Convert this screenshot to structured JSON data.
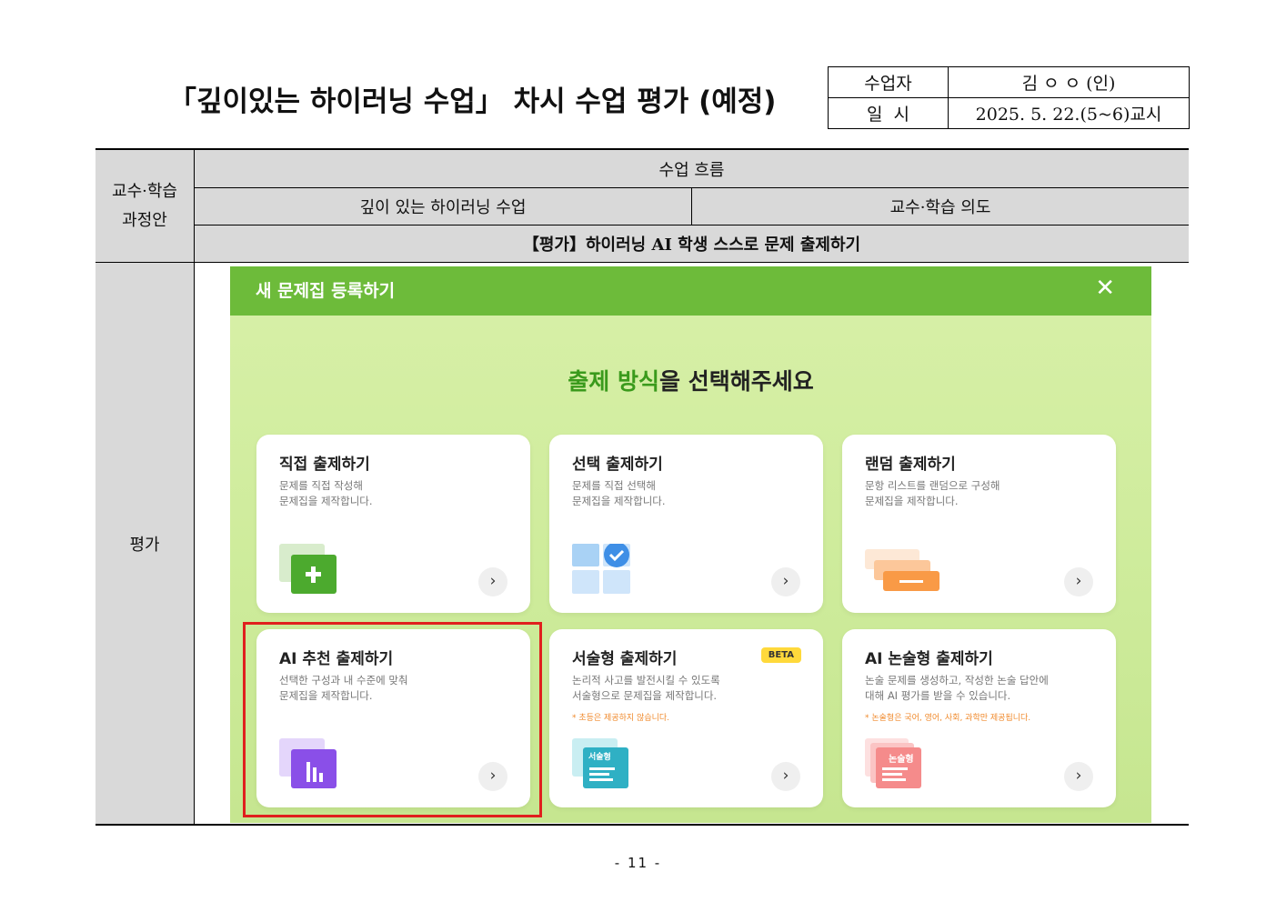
{
  "document": {
    "title": "「깊이있는 하이러닝 수업」 차시 수업 평가 (예정)",
    "meta": {
      "teacher_label": "수업자",
      "teacher_value": "김 ㅇ ㅇ (인)",
      "date_label": "일  시",
      "date_value": "2025. 5. 22.(5~6)교시"
    },
    "plan": {
      "left_top_line1": "교수·학습",
      "left_top_line2": "과정안",
      "left_bottom": "평가",
      "flow_header": "수업 흐름",
      "col_a": "깊이 있는 하이러닝 수업",
      "col_b": "교수·학습 의도",
      "activity_tag": "【평가】",
      "activity_text": "하이러닝 AI 학생 스스로 문제 출제하기"
    },
    "page_number": "- 11 -"
  },
  "screenshot": {
    "modal_title": "새 문제집 등록하기",
    "close_symbol": "✕",
    "heading_accent": "출제 방식",
    "heading_rest": "을 선택해주세요",
    "arrow_symbol": "›",
    "cards": [
      {
        "title": "직접 출제하기",
        "desc1": "문제를 직접 작성해",
        "desc2": "문제집을 제작합니다.",
        "icon": "plus-icon"
      },
      {
        "title": "선택 출제하기",
        "desc1": "문제를 직접 선택해",
        "desc2": "문제집을 제작합니다.",
        "icon": "grid-check-icon"
      },
      {
        "title": "랜덤 출제하기",
        "desc1": "문항 리스트를 랜덤으로 구성해",
        "desc2": "문제집을 제작합니다.",
        "icon": "stack-icon"
      },
      {
        "title": "AI 추천 출제하기",
        "desc1": "선택한 구성과 내 수준에 맞춰",
        "desc2": "문제집을 제작합니다.",
        "icon": "bar-chart-icon"
      },
      {
        "title": "서술형 출제하기",
        "desc1": "논리적 사고를 발전시킬 수 있도록",
        "desc2": "서술형으로 문제집을 제작합니다.",
        "note": "* 초등은 제공하지 않습니다.",
        "badge": "BETA",
        "icon_label": "서술형",
        "icon": "essay-doc-icon"
      },
      {
        "title": "AI 논술형 출제하기",
        "desc1": "논술 문제를 생성하고, 작성한 논술 답안에",
        "desc2": "대해 AI 평가를 받을 수 있습니다.",
        "note": "* 논술형은 국어, 영어, 사회, 과학만 제공됩니다.",
        "icon_label": "논술형",
        "icon": "argument-doc-icon"
      }
    ],
    "colors": {
      "header_green": "#6dbb3a",
      "accent_green": "#3a9a1c",
      "highlight_red": "#e0201e",
      "beta_yellow": "#ffd93b"
    }
  }
}
